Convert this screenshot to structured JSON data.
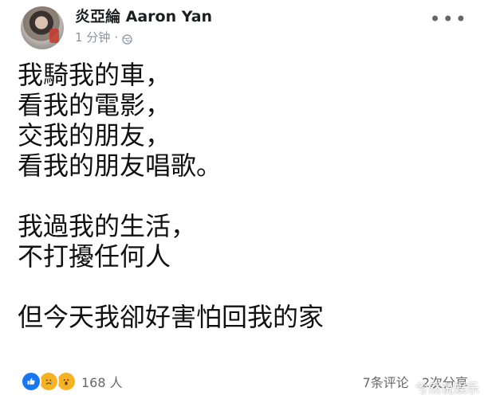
{
  "post": {
    "author": "炎亞綸 Aaron Yan",
    "time": "1 分钟",
    "separator": "·",
    "menu_icon": "more-horizontal-icon",
    "globe_icon": "globe-icon",
    "paragraphs": [
      [
        "我騎我的車，",
        "看我的電影，",
        "交我的朋友，",
        "看我的朋友唱歌。"
      ],
      [
        "我過我的生活，",
        "不打擾任何人"
      ],
      [
        "但今天我卻好害怕回我的家"
      ]
    ],
    "reactions": {
      "icons": [
        "like-icon",
        "sad-icon",
        "wow-icon"
      ],
      "count": "168 人"
    },
    "comments": "7条评论",
    "shares": "2次分享"
  },
  "watermark": {
    "text": "兮然说娱乐"
  },
  "colors": {
    "text": "#1c1e21",
    "muted": "#8d949e",
    "like_blue": "#1877f2",
    "emoji_yellow": "#f7b125"
  }
}
